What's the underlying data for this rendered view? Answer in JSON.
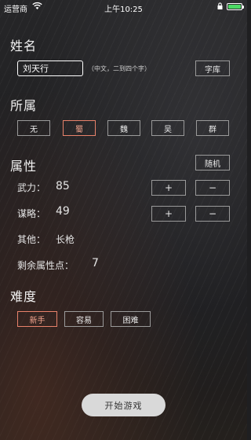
{
  "status": {
    "carrier": "运营商",
    "time": "上午10:25"
  },
  "name": {
    "title": "姓名",
    "value": "刘天行",
    "hint": "（中文，二到四个字）",
    "library_button": "字库"
  },
  "faction": {
    "title": "所属",
    "options": [
      "无",
      "蜀",
      "魏",
      "吴",
      "群"
    ],
    "selected": "蜀"
  },
  "attributes": {
    "title": "属性",
    "random_button": "随机",
    "force_label": "武力：",
    "force_value": "85",
    "strategy_label": "谋略：",
    "strategy_value": "49",
    "plus_label": "+",
    "minus_label": "−",
    "other_label": "其他：",
    "other_value": "长枪",
    "remaining_label": "剩余属性点：",
    "remaining_value": "7"
  },
  "difficulty": {
    "title": "难度",
    "options": [
      "新手",
      "容易",
      "困难"
    ],
    "selected": "新手"
  },
  "start_button": "开始游戏",
  "colors": {
    "accent": "#e8826b",
    "battery": "#4cd964",
    "button_bg": "#d9d9d9"
  }
}
